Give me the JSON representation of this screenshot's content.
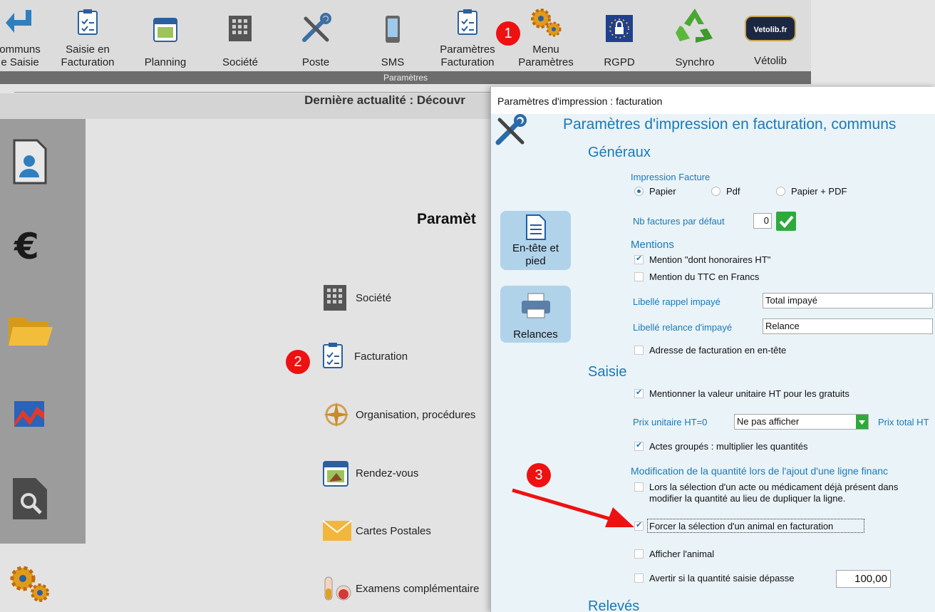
{
  "toolbar": {
    "items": [
      {
        "line1": "ommuns",
        "line2": "e Saisie"
      },
      {
        "line1": "Saisie en",
        "line2": "Facturation"
      },
      {
        "line1": "Planning"
      },
      {
        "line1": "Société"
      },
      {
        "line1": "Poste"
      },
      {
        "line1": "SMS"
      },
      {
        "line1": "Paramètres",
        "line2": "Facturation"
      },
      {
        "line1": "Menu",
        "line2": "Paramètres"
      },
      {
        "line1": "RGPD"
      },
      {
        "line1": "Synchro"
      },
      {
        "line1": "Vétolib"
      }
    ],
    "group_label": "Paramètres",
    "vetolib_logo_text": "Vetolib.fr"
  },
  "background": {
    "news": "Dernière actualité : Découvr",
    "title": "Paramèt",
    "items": [
      "Société",
      "Facturation",
      "Organisation, procédures",
      "Rendez-vous",
      "Cartes Postales",
      "Examens complémentaire"
    ]
  },
  "badges": [
    "1",
    "2",
    "3"
  ],
  "dialog": {
    "title": "Paramètres  d'impression : facturation",
    "heading": "Paramètres d'impression en facturation, communs",
    "side_buttons": {
      "header_footer": "En-tête et pied",
      "reminders": "Relances"
    },
    "generaux": {
      "title": "Généraux",
      "print_invoice_label": "Impression Facture",
      "options": [
        "Papier",
        "Pdf",
        "Papier + PDF"
      ],
      "selected_option": "Papier",
      "nb_invoices_label": "Nb factures par défaut",
      "nb_invoices_value": "0"
    },
    "mentions": {
      "title": "Mentions",
      "items": [
        {
          "label": "Mention \"dont honoraires HT\"",
          "checked": true
        },
        {
          "label": "Mention du TTC en Francs",
          "checked": false
        }
      ],
      "rappel_label": "Libellé rappel impayé",
      "rappel_value": "Total impayé",
      "relance_label": "Libellé relance d'impayé",
      "relance_value": "Relance",
      "address_label": "Adresse de facturation en en-tête",
      "address_checked": false
    },
    "saisie": {
      "title": "Saisie",
      "unit_value_label": "Mentionner la valeur unitaire HT pour les gratuits",
      "unit_value_checked": true,
      "price_label": "Prix unitaire HT=0",
      "price_select_value": "Ne pas afficher",
      "price_total_label": "Prix total HT",
      "grouped_label": "Actes groupés : multiplier les quantités",
      "grouped_checked": true,
      "modif_title": "Modification de la quantité lors de l'ajout d'une ligne financ",
      "modif_line1": "Lors la sélection d'un acte ou médicament déjà présent dans",
      "modif_line2": "modifier la quantité au lieu de dupliquer la ligne.",
      "modif_checked": false,
      "force_label": "Forcer la sélection d'un animal en facturation",
      "force_checked": true,
      "show_animal_label": "Afficher l'animal",
      "show_animal_checked": false,
      "warn_label": "Avertir si la quantité saisie dépasse",
      "warn_checked": false,
      "warn_value": "100,00"
    },
    "releves_title": "Relevés"
  },
  "colors": {
    "accent": "#1a7ab8",
    "badge": "#e11111",
    "side_button": "#b0d3ea",
    "check_green": "#2eaa3c"
  }
}
